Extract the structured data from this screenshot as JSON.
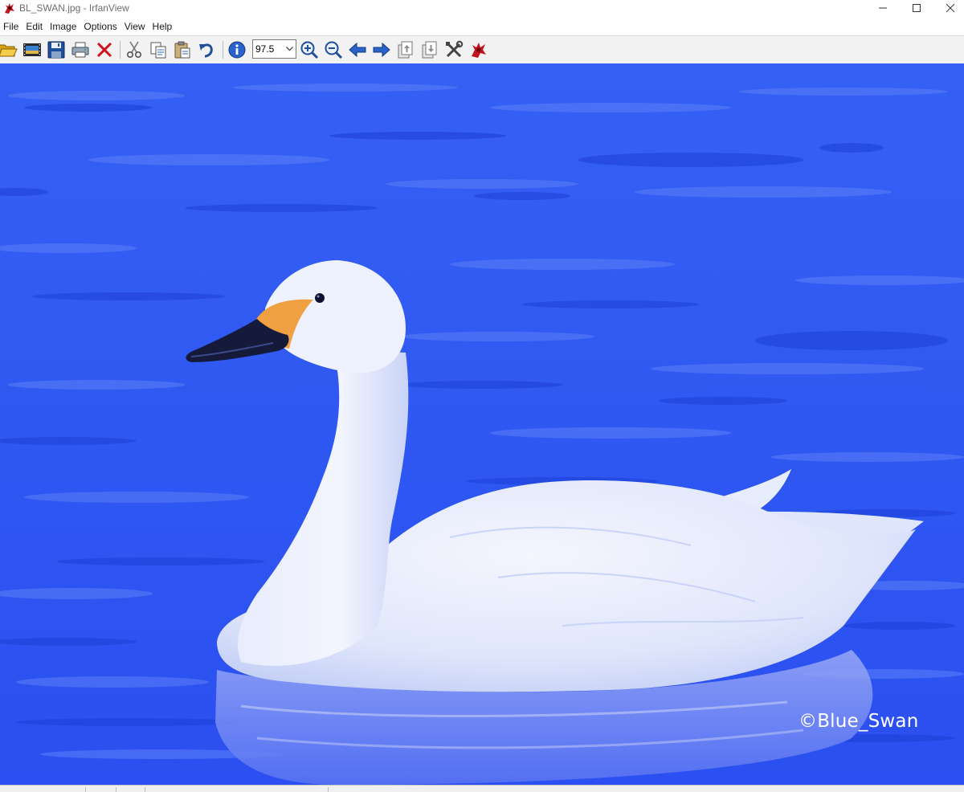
{
  "window": {
    "title": "BL_SWAN.jpg - IrfanView",
    "icon": "irfanview-cat-icon",
    "controls": [
      "minimize-icon",
      "maximize-icon",
      "close-icon"
    ]
  },
  "menu": {
    "items": [
      "File",
      "Edit",
      "Image",
      "Options",
      "View",
      "Help"
    ]
  },
  "toolbar": {
    "buttons": [
      "open-folder-icon",
      "slideshow-icon",
      "save-icon",
      "print-icon",
      "delete-icon",
      "cut-icon",
      "copy-icon",
      "paste-icon",
      "undo-icon",
      "info-icon",
      "zoom-in-icon",
      "zoom-out-icon",
      "previous-arrow-icon",
      "next-arrow-icon",
      "first-page-icon",
      "last-page-icon",
      "properties-tools-icon",
      "irfanview-cat-icon"
    ],
    "zoom_value": "97.5"
  },
  "image": {
    "filename": "BL_SWAN.jpg",
    "subject": "swan-photo",
    "watermark": "©Blue_Swan"
  },
  "colors": {
    "water": "#2d55f5",
    "swan": "#dfe6fb",
    "beak_orange": "#f0a040",
    "toolbar_bg": "#f2f2f2"
  }
}
